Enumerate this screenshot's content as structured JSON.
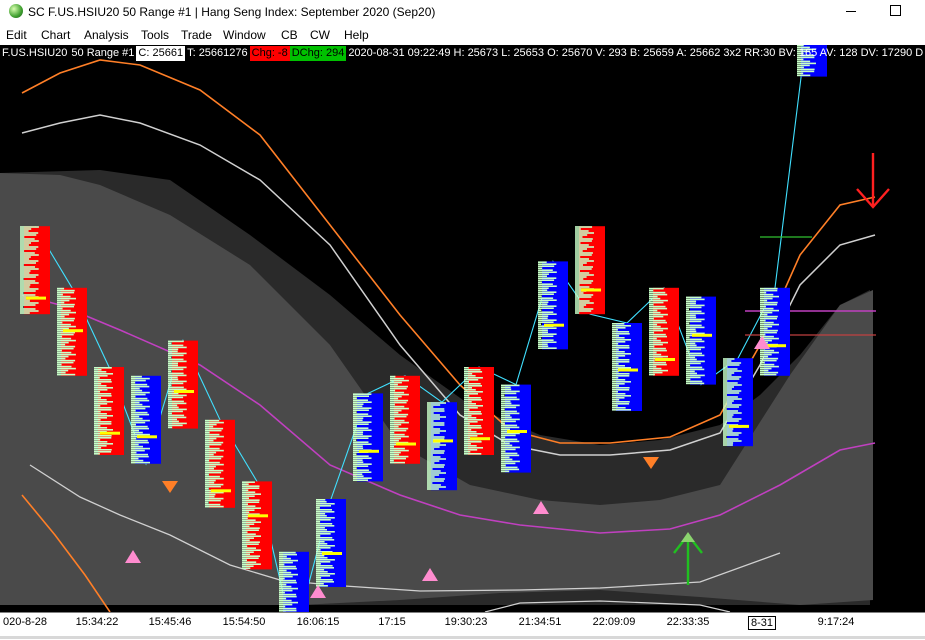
{
  "window": {
    "title": "SC F.US.HSIU20  50 Range  #1 | Hang Seng Index: September 2020 (Sep20)",
    "controls": {
      "minimize": "–",
      "maximize": "☐"
    }
  },
  "menu": [
    "Edit",
    "Chart",
    "Analysis",
    "Tools",
    "Trade",
    "Window",
    "CB",
    "CW",
    "Help"
  ],
  "info_bar": {
    "symbol": "F.US.HSIU20",
    "range": "50 Range  #1",
    "close": "C: 25661",
    "ticks": "T: 25661276",
    "change": "Chg: -8",
    "daily_change": "DChg: 294",
    "details": "2020-08-31 09:22:49 H: 25673 L: 25653 O: 25670 V: 293 B: 25659 A: 25662 3x2 RR:30 BV: 165 AV: 128 DV: 17290 D"
  },
  "time_axis": {
    "labels": [
      "020-8-28",
      "15:34:22",
      "15:45:46",
      "15:54:50",
      "16:06:15",
      "17:15",
      "19:30:23",
      "21:34:51",
      "22:09:09",
      "22:33:35",
      "8-31",
      "9:17:24"
    ],
    "highlighted": "8-31"
  },
  "colors": {
    "background": "#000000",
    "band_fill": "#4a4a4a",
    "band_fill_light": "#2a2a2a",
    "orange_line": "#ff7f27",
    "white_line": "#d0d0d0",
    "magenta_line": "#c040c0",
    "price_line": "#40e0ff",
    "bar_red": "#ff0000",
    "bar_blue": "#0000ff",
    "volume_profile": "#c8ffc8",
    "poc_yellow": "#ffff00",
    "signal_pink": "#ff8ccf",
    "signal_orange": "#ff7f27",
    "arrow_green": "#20c020",
    "arrow_red": "#ff2020"
  },
  "chart_data": {
    "type": "candlestick",
    "symbol": "F.US.HSIU20",
    "bars": [
      {
        "dir": "up",
        "o": 25430,
        "c": 25480
      },
      {
        "dir": "up",
        "o": 25395,
        "c": 25445
      },
      {
        "dir": "up",
        "o": 25350,
        "c": 25400
      },
      {
        "dir": "down",
        "o": 25395,
        "c": 25345
      },
      {
        "dir": "up",
        "o": 25365,
        "c": 25415
      },
      {
        "dir": "up",
        "o": 25320,
        "c": 25370
      },
      {
        "dir": "up",
        "o": 25285,
        "c": 25335
      },
      {
        "dir": "down",
        "o": 25295,
        "c": 25245
      },
      {
        "dir": "down",
        "o": 25275,
        "c": 25325
      },
      {
        "dir": "down",
        "o": 25335,
        "c": 25385
      },
      {
        "dir": "up",
        "o": 25345,
        "c": 25395
      },
      {
        "dir": "down",
        "o": 25330,
        "c": 25380
      },
      {
        "dir": "up",
        "o": 25350,
        "c": 25400
      },
      {
        "dir": "down",
        "o": 25340,
        "c": 25390
      },
      {
        "dir": "down",
        "o": 25410,
        "c": 25460
      },
      {
        "dir": "up",
        "o": 25480,
        "c": 25430
      },
      {
        "dir": "down",
        "o": 25375,
        "c": 25425
      },
      {
        "dir": "up",
        "o": 25395,
        "c": 25445
      },
      {
        "dir": "down",
        "o": 25440,
        "c": 25390
      },
      {
        "dir": "down",
        "o": 25355,
        "c": 25405
      },
      {
        "dir": "down",
        "o": 25395,
        "c": 25445
      },
      {
        "dir": "down",
        "o": 25565,
        "c": 25615
      },
      {
        "dir": "down",
        "o": 25625,
        "c": 25675
      },
      {
        "dir": "down",
        "o": 25665,
        "c": 25715
      },
      {
        "dir": "up",
        "o": 25700,
        "c": 25750
      },
      {
        "dir": "up",
        "o": 25670,
        "c": 25661
      }
    ]
  }
}
